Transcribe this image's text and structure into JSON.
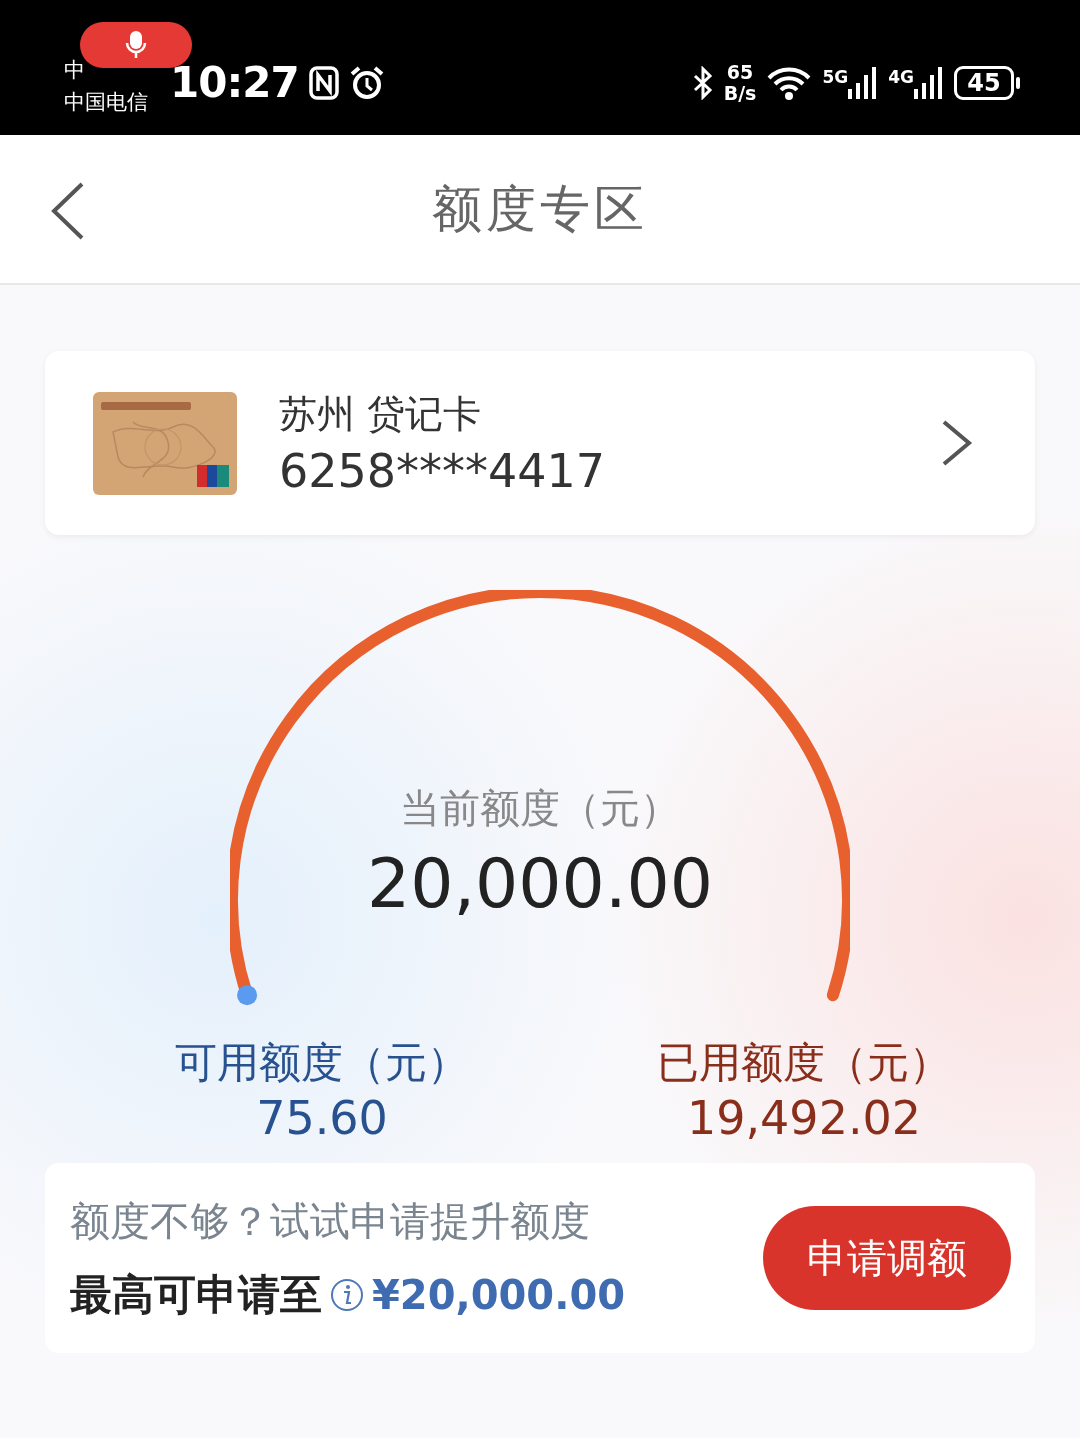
{
  "status_bar": {
    "carrier_1": "中",
    "carrier_2": "中国电信",
    "time": "10:27",
    "net_speed_value": "65",
    "net_speed_unit": "B/s",
    "signal_1_type": "5G",
    "signal_2_type": "4G",
    "battery": "45",
    "recording": true
  },
  "nav": {
    "title": "额度专区"
  },
  "card": {
    "name": "苏州 贷记卡",
    "number": "6258****4417"
  },
  "gauge": {
    "label": "当前额度（元）",
    "value": "20,000.00",
    "available_label": "可用额度（元）",
    "available_value": "75.60",
    "used_label": "已用额度（元）",
    "used_value": "19,492.02"
  },
  "promo": {
    "hint": "额度不够？试试申请提升额度",
    "max_label": "最高可申请至",
    "max_value": "¥20,000.00",
    "button": "申请调额"
  }
}
